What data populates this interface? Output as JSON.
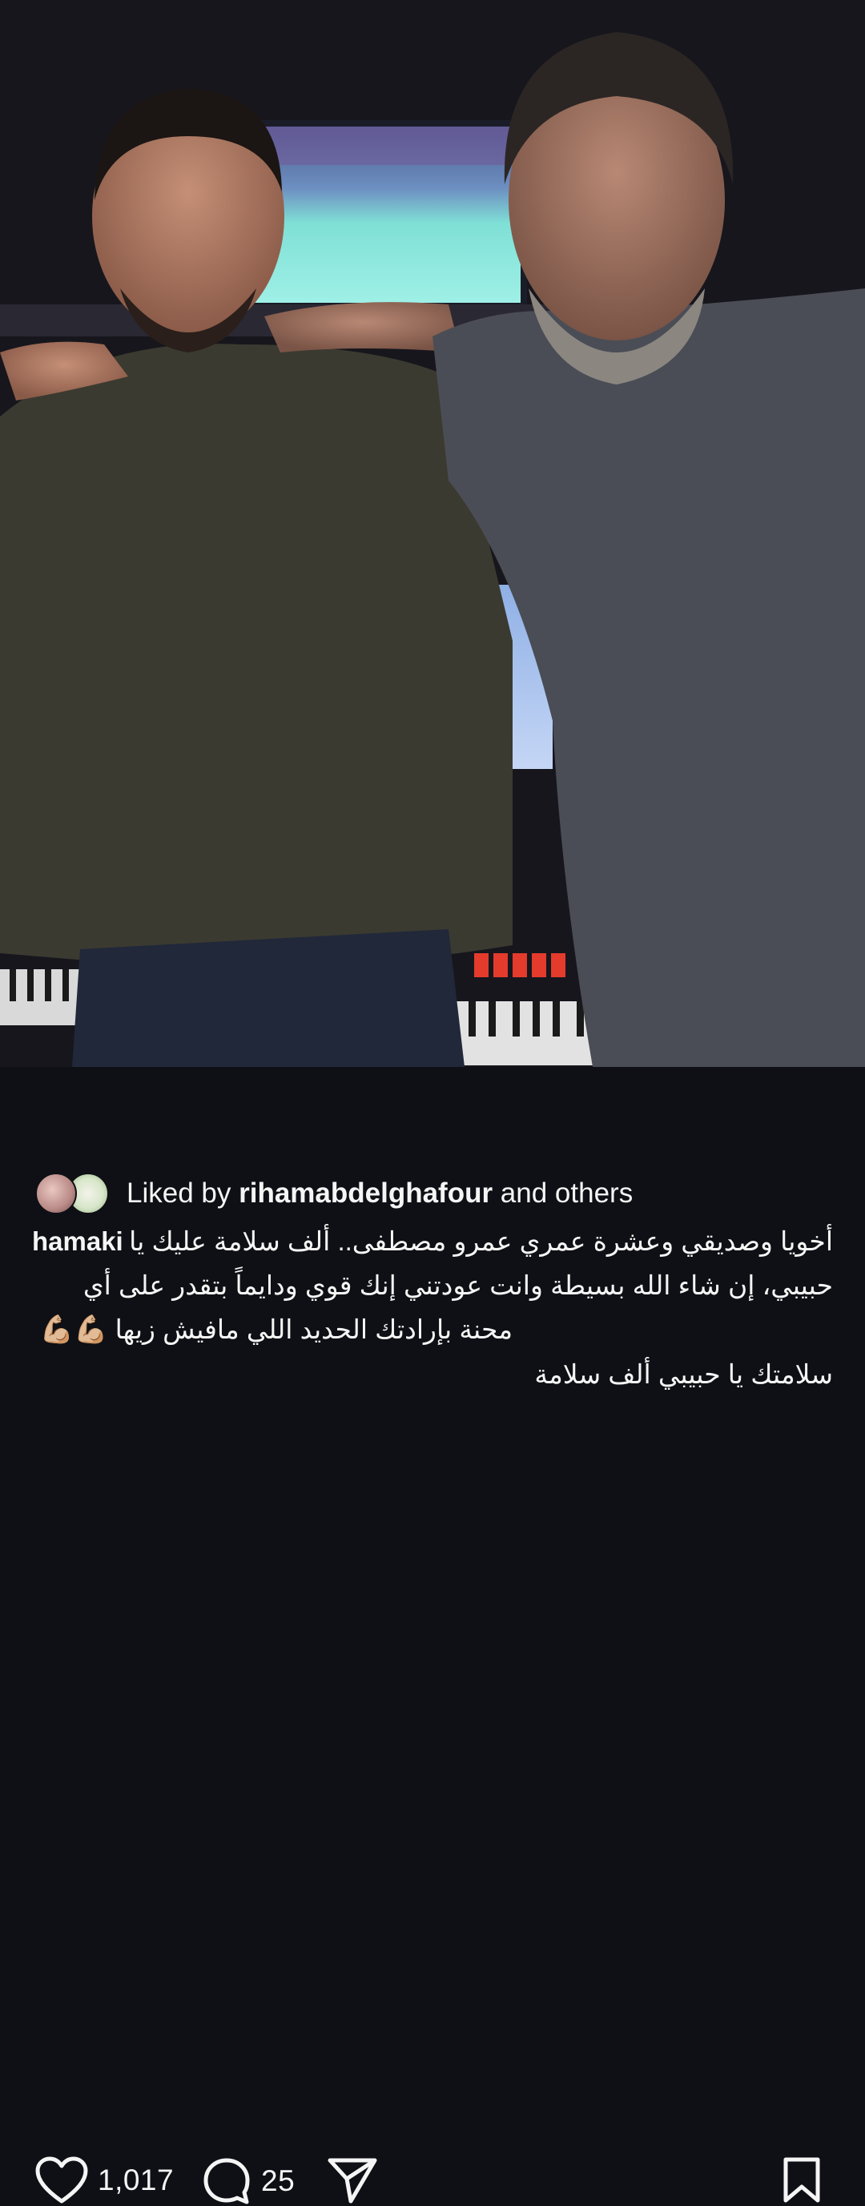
{
  "post": {
    "photo_alt": "Two men smiling in a music studio",
    "actions": {
      "likes_count": "1,017",
      "comments_count": "25"
    },
    "liked_by": {
      "prefix": "Liked by ",
      "user": "rihamabdelghafour",
      "suffix": " and others"
    },
    "caption": {
      "username": "hamaki",
      "line1": "أخويا وصديقي وعشرة عمري عمرو مصطفى.. ألف سلامة عليك يا",
      "line2": "حبيبي، إن شاء الله بسيطة وانت عودتني إنك قوي ودايماً بتقدر على أي",
      "line3": "محنة بإرادتك الحديد اللي مافيش زيها",
      "emoji": "💪🏼💪🏼",
      "line4": "سلامتك يا حبيبي ألف سلامة"
    }
  },
  "icons": {
    "like": "heart-outline-icon",
    "comment": "comment-bubble-icon",
    "share": "paper-plane-icon",
    "save": "bookmark-icon"
  },
  "colors": {
    "background": "#0f1015",
    "text": "#f5f5f5"
  }
}
